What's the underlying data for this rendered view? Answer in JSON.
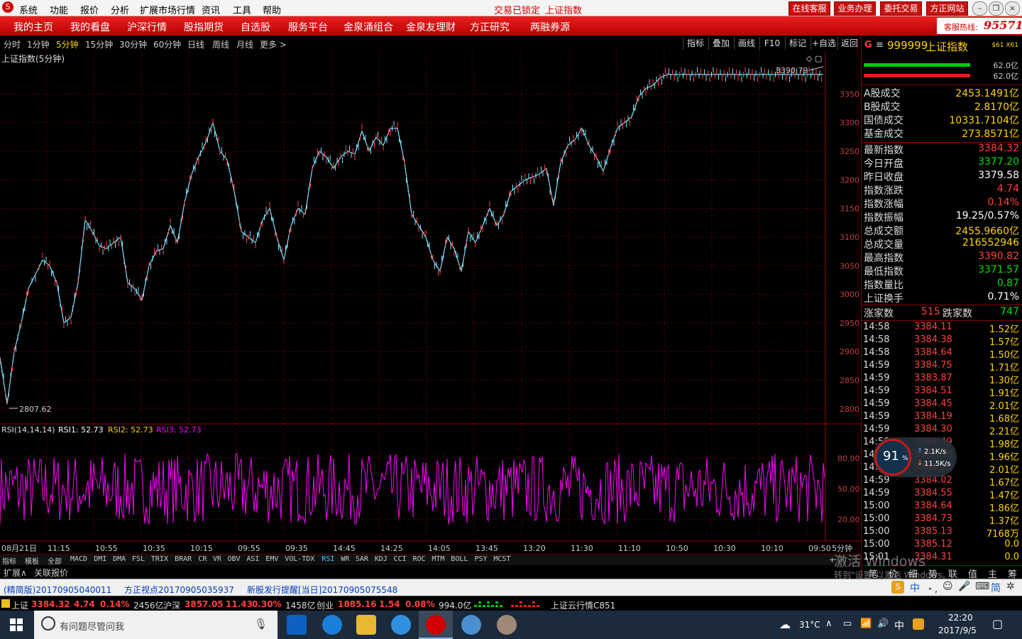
{
  "titlebar": {
    "menus": [
      "系统",
      "功能",
      "报价",
      "分析",
      "扩展市场行情",
      "资讯",
      "工具",
      "帮助"
    ],
    "status_locked": "交易已锁定",
    "status_index": "上证指数",
    "buttons": [
      "在线客服",
      "业务办理",
      "委托交易",
      "方正网站"
    ]
  },
  "navbar": {
    "items": [
      "我的主页",
      "我的看盘",
      "沪深行情",
      "股指期货",
      "自选股",
      "服务平台",
      "金泉涌组合",
      "金泉友理财",
      "方正研究",
      "两融券源"
    ],
    "hotline_label": "客服热线:",
    "hotline_number": "95571"
  },
  "periods": {
    "items": [
      "分时",
      "1分钟",
      "5分钟",
      "15分钟",
      "30分钟",
      "60分钟",
      "日线",
      "周线",
      "月线",
      "更多 >"
    ],
    "active": "5分钟",
    "tools": [
      "指标",
      "叠加",
      "画线",
      "F10",
      "标记",
      "+自选",
      "返回"
    ]
  },
  "chart": {
    "title": "上证指数(5分钟)",
    "y_ticks": [
      "3350",
      "3300",
      "3250",
      "3200",
      "3150",
      "3100",
      "3050",
      "3000",
      "2950",
      "2900",
      "2850",
      "2800"
    ],
    "high_label": "3390.79",
    "low_label": "2807.62",
    "x_labels": [
      "08月21日",
      "11:15",
      "10:55",
      "10:35",
      "10:15",
      "09:55",
      "09:35",
      "14:45",
      "14:25",
      "14:05",
      "13:45",
      "13:20",
      "11:30",
      "11:10",
      "10:50",
      "10:30",
      "10:10",
      "09:50"
    ],
    "x_period": "5分钟",
    "rsi_label": "RSI(14,14,14)",
    "rsi1": "RSI1: 52.73",
    "rsi2": "RSI2: 52.73",
    "rsi3": "RSI3: 52.73",
    "rsi_ticks": [
      "80.00",
      "50.00",
      "20.00"
    ]
  },
  "chart_data": {
    "type": "line",
    "title": "上证指数(5分钟)",
    "x_labels": [
      "08月21日",
      "11:15",
      "10:55",
      "10:35",
      "10:15",
      "09:55",
      "09:35",
      "14:45",
      "14:25",
      "14:05",
      "13:45",
      "13:20",
      "11:30",
      "11:10",
      "10:50",
      "10:30",
      "10:10",
      "09:50"
    ],
    "ylim": [
      2780,
      3400
    ],
    "series": [
      {
        "name": "上证指数",
        "color": "#7fe0ff",
        "x": [
          0,
          10,
          20,
          30,
          40,
          60,
          70,
          80,
          90,
          100,
          110,
          120,
          130,
          140,
          150,
          160,
          170,
          180,
          190,
          200,
          210,
          220,
          230,
          240,
          250,
          260,
          270,
          280,
          290,
          300,
          310,
          320,
          330,
          340,
          350,
          360,
          370,
          380,
          390,
          400,
          410,
          420,
          430,
          440,
          450,
          460,
          470,
          480,
          490,
          500,
          510,
          520,
          530,
          540,
          550,
          560,
          570,
          580,
          590,
          600,
          610,
          620,
          630,
          640,
          650,
          660,
          670,
          680,
          690,
          700,
          710,
          720,
          730,
          740,
          750,
          760,
          770,
          780,
          790,
          800,
          810,
          820,
          830,
          840,
          850,
          860,
          870,
          880,
          890,
          900,
          910,
          920,
          930,
          940,
          950,
          960,
          970,
          980,
          990,
          1000,
          1010,
          1020,
          1030,
          1040,
          1050,
          1060,
          1070,
          1080,
          1090,
          1100,
          1110,
          1120,
          1130,
          1140,
          1150,
          1160
        ],
        "y": [
          2890,
          2808,
          2900,
          2950,
          3010,
          3060,
          3050,
          3020,
          2950,
          2960,
          3020,
          3130,
          3110,
          3085,
          3080,
          3090,
          3100,
          3020,
          3010,
          2990,
          3050,
          3075,
          3080,
          3120,
          3090,
          3160,
          3210,
          3240,
          3265,
          3300,
          3250,
          3235,
          3180,
          3110,
          3100,
          3090,
          3130,
          3150,
          3100,
          3060,
          3120,
          3150,
          3140,
          3220,
          3250,
          3240,
          3220,
          3240,
          3250,
          3245,
          3285,
          3250,
          3275,
          3260,
          3290,
          3290,
          3230,
          3140,
          3120,
          3100,
          3060,
          3040,
          3100,
          3080,
          3040,
          3110,
          3090,
          3120,
          3150,
          3120,
          3140,
          3180,
          3190,
          3200,
          3205,
          3210,
          3220,
          3155,
          3230,
          3260,
          3270,
          3290,
          3260,
          3240,
          3215,
          3255,
          3290,
          3300,
          3310,
          3345,
          3360,
          3365,
          3378,
          3384,
          3384,
          3384,
          3384,
          3384,
          3384,
          3384,
          3384,
          3384,
          3384,
          3384,
          3384,
          3384,
          3384,
          3384,
          3384,
          3384,
          3384,
          3384,
          3384,
          3384,
          3384,
          3384
        ]
      }
    ],
    "rsi": {
      "name": "RSI",
      "color": "#ff00ff",
      "ylim": [
        0,
        100
      ],
      "ticks": [
        80,
        50,
        20
      ]
    }
  },
  "right": {
    "code": "999999",
    "name": "上证指数",
    "tag": "$61 X61",
    "bar1_pct": "62.0亿",
    "bar2_pct": "62.0亿",
    "volumes": [
      {
        "l": "A股成交",
        "v": "2453.1491亿"
      },
      {
        "l": "B股成交",
        "v": "2.8170亿"
      },
      {
        "l": "国债成交",
        "v": "10331.7104亿"
      },
      {
        "l": "基金成交",
        "v": "273.8571亿"
      }
    ],
    "stats": [
      {
        "l": "最新指数",
        "v": "3384.32",
        "c": "#ff4040"
      },
      {
        "l": "今日开盘",
        "v": "3377.20",
        "c": "#00e000"
      },
      {
        "l": "昨日收盘",
        "v": "3379.58",
        "c": "#ffffff"
      },
      {
        "l": "指数涨跌",
        "v": "4.74",
        "c": "#ff4040"
      },
      {
        "l": "指数涨幅",
        "v": "0.14%",
        "c": "#ff4040"
      },
      {
        "l": "指数振幅",
        "v": "19.25/0.57%",
        "c": "#ffffff"
      },
      {
        "l": "总成交额",
        "v": "2455.9660亿",
        "c": "#ffd400"
      },
      {
        "l": "总成交量",
        "v": "216552946",
        "c": "#ffd400"
      },
      {
        "l": "最高指数",
        "v": "3390.82",
        "c": "#ff4040"
      },
      {
        "l": "最低指数",
        "v": "3371.57",
        "c": "#00e000"
      },
      {
        "l": "指数量比",
        "v": "0.87",
        "c": "#00e000"
      },
      {
        "l": "上证换手",
        "v": "0.71%",
        "c": "#ffffff"
      }
    ],
    "adv_label": "涨家数",
    "adv_value": "515",
    "dec_label": "跌家数",
    "dec_value": "747",
    "ticks": [
      {
        "t": "14:58",
        "p": "3384.11",
        "a": "1.52亿"
      },
      {
        "t": "14:58",
        "p": "3384.38",
        "a": "1.57亿"
      },
      {
        "t": "14:58",
        "p": "3384.64",
        "a": "1.50亿"
      },
      {
        "t": "14:59",
        "p": "3384.75",
        "a": "1.71亿"
      },
      {
        "t": "14:59",
        "p": "3383.87",
        "a": "1.30亿"
      },
      {
        "t": "14:59",
        "p": "3384.51",
        "a": "1.91亿"
      },
      {
        "t": "14:59",
        "p": "3384.45",
        "a": "2.01亿"
      },
      {
        "t": "14:59",
        "p": "3384.19",
        "a": "1.68亿"
      },
      {
        "t": "14:59",
        "p": "3384.30",
        "a": "2.21亿"
      },
      {
        "t": "14:59",
        "p": "3384.49",
        "a": "1.98亿"
      },
      {
        "t": "14:59",
        "p": "3384.38",
        "a": "1.96亿"
      },
      {
        "t": "14:59",
        "p": "3384.28",
        "a": "2.01亿"
      },
      {
        "t": "14:59",
        "p": "3384.02",
        "a": "1.67亿"
      },
      {
        "t": "14:59",
        "p": "3384.55",
        "a": "1.47亿"
      },
      {
        "t": "15:00",
        "p": "3384.64",
        "a": "1.86亿"
      },
      {
        "t": "15:00",
        "p": "3384.73",
        "a": "1.37亿"
      },
      {
        "t": "15:00",
        "p": "3385.13",
        "a": "7168万"
      },
      {
        "t": "15:00",
        "p": "3385.12",
        "a": "0.0"
      },
      {
        "t": "15:01",
        "p": "3384.31",
        "a": "0.0"
      }
    ],
    "bottom_tabs": [
      "笔",
      "价",
      "细",
      "势",
      "联",
      "值",
      "主",
      "筹"
    ]
  },
  "indicators": [
    "指标",
    "模板",
    "全部",
    "MACD",
    "DMI",
    "DMA",
    "FSL",
    "TRIX",
    "BRAR",
    "CR",
    "VR",
    "OBV",
    "ASI",
    "EMV",
    "VOL-TDX",
    "RSI",
    "WR",
    "SAR",
    "KDJ",
    "CCI",
    "ROC",
    "MTM",
    "BOLL",
    "PSY",
    "MCST"
  ],
  "indicator_active": "RSI",
  "subtabs": [
    "扩展∧",
    "关联报价"
  ],
  "news": [
    "(精简版)20170905040011",
    "方正视点20170905035937",
    "新股发行提醒[当日]20170905075548"
  ],
  "indexbar": [
    {
      "name": "上证",
      "v": "3384.32",
      "c": "4.74",
      "p": "0.14%",
      "amt": "2456亿"
    },
    {
      "name": "沪深",
      "v": "3857.05",
      "c": "11.43",
      "p": "0.30%",
      "amt": "1458亿"
    },
    {
      "name": "创业",
      "v": "1885.16",
      "c": "1.54",
      "p": "0.08%",
      "amt": "994.0亿"
    }
  ],
  "cloud": "上证云行情C851",
  "ime": [
    "中",
    "简"
  ],
  "net": {
    "pct": "91",
    "unit": "%",
    "up": "2.1K/s",
    "down": "11.5K/s"
  },
  "watermark": {
    "line1": "激活 Windows",
    "line2": "转到\"设置\"以激活 Windows。"
  },
  "taskbar": {
    "search": "有问题尽管问我",
    "temp": "31°C",
    "ime": "中",
    "time": "22:20",
    "date": "2017/9/5"
  }
}
